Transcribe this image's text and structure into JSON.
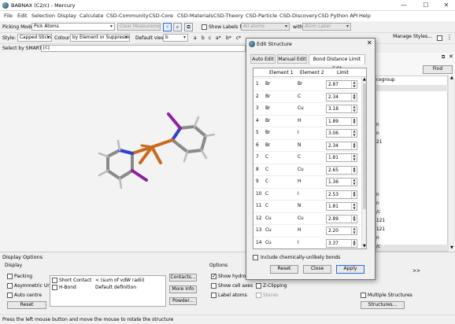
{
  "window": {
    "title": "BABNAX (C2/c) - Mercury"
  },
  "menu": [
    "File",
    "Edit",
    "Selection",
    "Display",
    "Calculate",
    "CSD-Community",
    "CSD-Core",
    "CSD-Materials",
    "CSD-Theory",
    "CSD-Particle",
    "CSD-Discovery",
    "CSD Python API",
    "Help"
  ],
  "toolbar1": {
    "picking_mode_label": "Picking Mode:",
    "picking_mode_value": "Pick Atoms",
    "clear_measurements": "Clear Measurements",
    "show_labels_label": "Show Labels for",
    "labels_for_value": "All atoms",
    "with_label": "with",
    "atom_label_value": "Atom Label"
  },
  "toolbar2": {
    "style_label": "Style:",
    "style_value": "Capped Sticks",
    "colour_label": "Colour:",
    "colour_value": "by Element or Suppression",
    "default_view_label": "Default view:",
    "default_view_value": "b",
    "axes": [
      "a",
      "b",
      "c",
      "a*",
      "b*",
      "c*"
    ],
    "manage_styles": "Manage Styles..."
  },
  "toolbar3": {
    "smarts_label": "Select by SMARTS:",
    "smarts_value": "[c]"
  },
  "right_panel": {
    "find": "Find",
    "items": [
      "cegroup",
      "",
      "",
      "n",
      "n",
      "21",
      "",
      "",
      "",
      "",
      "",
      "n",
      "n",
      "/c",
      "121",
      "121",
      "",
      "n",
      "/c",
      "/c",
      "/c",
      "121"
    ],
    "nav": ">>"
  },
  "display_options": {
    "title": "Display Options",
    "display_group": "Display",
    "packing": "Packing",
    "asym_unit": "Asymmetric Unit",
    "auto_centre": "Auto centre",
    "reset": "Reset",
    "contacts": [
      {
        "name": "Short Contact",
        "def": "< (sum of vdW radii)"
      },
      {
        "name": "H-Bond",
        "def": "Default definition"
      }
    ],
    "contacts_btn": "Contacts...",
    "more_info_btn": "More Info",
    "powder_btn": "Powder...",
    "options_group": "Options",
    "show_hydrogens": "Show hydrog",
    "show_cell_axes": "Show cell axes",
    "label_atoms": "Label atoms",
    "z_clipping": "Z-Clipping",
    "stereo": "Stereo",
    "multiple_structures": "Multiple Structures",
    "structures_btn": "Structures..."
  },
  "status": "Press the left mouse button and move the mouse to rotate the structure",
  "dialog": {
    "title": "Edit Structure",
    "tabs": [
      "Auto Edit",
      "Manual Edit",
      "Bond Distance Limit Edit"
    ],
    "headers": [
      "Element 1",
      "Element 2",
      "Limit"
    ],
    "rows": [
      {
        "n": "1",
        "e1": "Br",
        "e2": "Br",
        "limit": "2.87"
      },
      {
        "n": "2",
        "e1": "Br",
        "e2": "C",
        "limit": "2.34"
      },
      {
        "n": "3",
        "e1": "Br",
        "e2": "Cu",
        "limit": "3.18"
      },
      {
        "n": "4",
        "e1": "Br",
        "e2": "H",
        "limit": "1.89"
      },
      {
        "n": "5",
        "e1": "Br",
        "e2": "I",
        "limit": "3.06"
      },
      {
        "n": "6",
        "e1": "Br",
        "e2": "N",
        "limit": "2.34"
      },
      {
        "n": "7",
        "e1": "C",
        "e2": "C",
        "limit": "1.81"
      },
      {
        "n": "8",
        "e1": "C",
        "e2": "Cu",
        "limit": "2.65"
      },
      {
        "n": "9",
        "e1": "C",
        "e2": "H",
        "limit": "1.36"
      },
      {
        "n": "10",
        "e1": "C",
        "e2": "I",
        "limit": "2.53"
      },
      {
        "n": "11",
        "e1": "C",
        "e2": "N",
        "limit": "1.81"
      },
      {
        "n": "12",
        "e1": "Cu",
        "e2": "Cu",
        "limit": "2.89"
      },
      {
        "n": "13",
        "e1": "Cu",
        "e2": "H",
        "limit": "2.20"
      },
      {
        "n": "14",
        "e1": "Cu",
        "e2": "I",
        "limit": "3.37"
      }
    ],
    "include_unlikely": "Include chemically-unlikely bonds",
    "reset": "Reset",
    "close": "Close",
    "apply": "Apply"
  }
}
